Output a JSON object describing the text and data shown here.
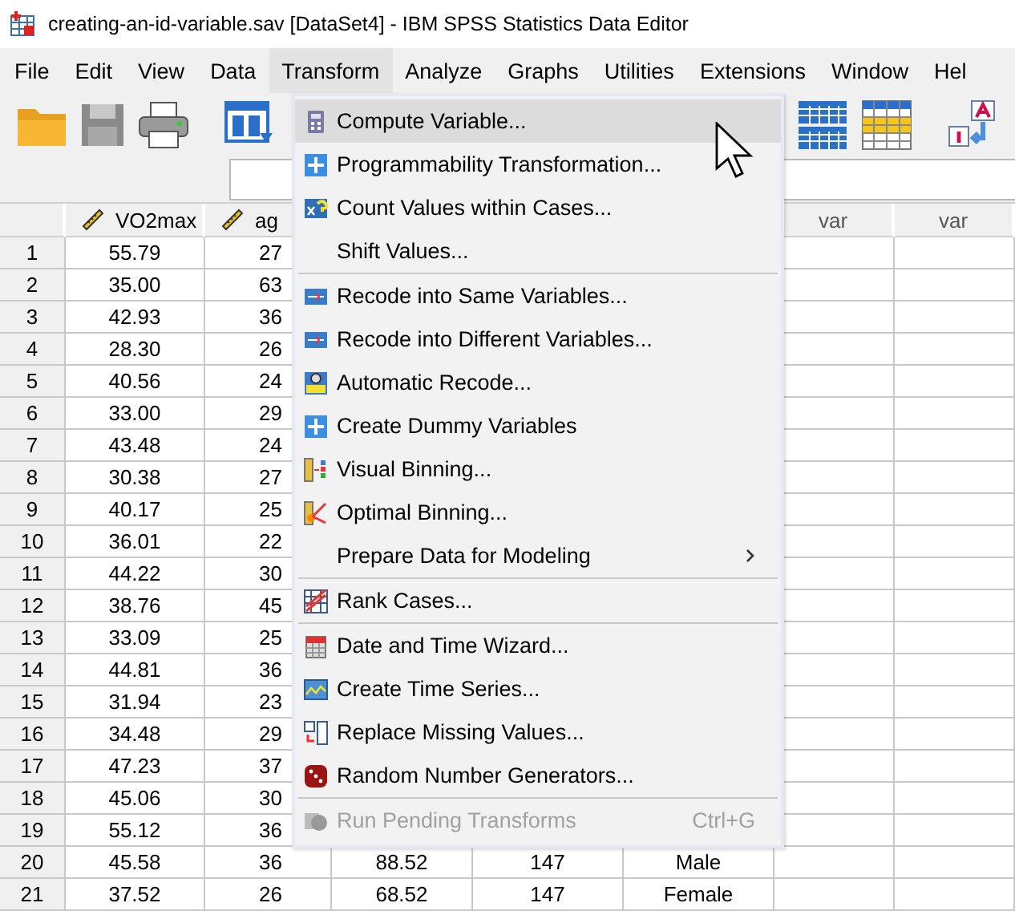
{
  "window": {
    "title": "creating-an-id-variable.sav [DataSet4] - IBM SPSS Statistics Data Editor"
  },
  "menubar": [
    {
      "label": "File",
      "selected": false
    },
    {
      "label": "Edit",
      "selected": false
    },
    {
      "label": "View",
      "selected": false
    },
    {
      "label": "Data",
      "selected": false
    },
    {
      "label": "Transform",
      "selected": true
    },
    {
      "label": "Analyze",
      "selected": false
    },
    {
      "label": "Graphs",
      "selected": false
    },
    {
      "label": "Utilities",
      "selected": false
    },
    {
      "label": "Extensions",
      "selected": false
    },
    {
      "label": "Window",
      "selected": false
    },
    {
      "label": "Hel",
      "selected": false
    }
  ],
  "columns": [
    {
      "header": "VO2max",
      "kind": "scale"
    },
    {
      "header": "ag",
      "kind": "scale"
    },
    {
      "kind": "covered"
    },
    {
      "kind": "covered"
    },
    {
      "kind": "covered"
    },
    {
      "header": "var",
      "kind": "empty"
    },
    {
      "header": "var",
      "kind": "empty"
    }
  ],
  "rows": [
    {
      "number": "1",
      "cells": [
        "55.79",
        "27"
      ]
    },
    {
      "number": "2",
      "cells": [
        "35.00",
        "63"
      ]
    },
    {
      "number": "3",
      "cells": [
        "42.93",
        "36"
      ]
    },
    {
      "number": "4",
      "cells": [
        "28.30",
        "26"
      ]
    },
    {
      "number": "5",
      "cells": [
        "40.56",
        "24"
      ]
    },
    {
      "number": "6",
      "cells": [
        "33.00",
        "29"
      ]
    },
    {
      "number": "7",
      "cells": [
        "43.48",
        "24"
      ]
    },
    {
      "number": "8",
      "cells": [
        "30.38",
        "27"
      ]
    },
    {
      "number": "9",
      "cells": [
        "40.17",
        "25"
      ]
    },
    {
      "number": "10",
      "cells": [
        "36.01",
        "22"
      ]
    },
    {
      "number": "11",
      "cells": [
        "44.22",
        "30"
      ]
    },
    {
      "number": "12",
      "cells": [
        "38.76",
        "45"
      ]
    },
    {
      "number": "13",
      "cells": [
        "33.09",
        "25"
      ]
    },
    {
      "number": "14",
      "cells": [
        "44.81",
        "36"
      ]
    },
    {
      "number": "15",
      "cells": [
        "31.94",
        "23"
      ]
    },
    {
      "number": "16",
      "cells": [
        "34.48",
        "29"
      ]
    },
    {
      "number": "17",
      "cells": [
        "47.23",
        "37"
      ]
    },
    {
      "number": "18",
      "cells": [
        "45.06",
        "30"
      ]
    },
    {
      "number": "19",
      "cells": [
        "55.12",
        "36"
      ]
    },
    {
      "number": "20",
      "cells": [
        "45.58",
        "36",
        "88.52",
        "147",
        "Male"
      ]
    },
    {
      "number": "21",
      "cells": [
        "37.52",
        "26",
        "68.52",
        "147",
        "Female"
      ]
    }
  ],
  "transform_menu": [
    {
      "kind": "item",
      "label": "Compute Variable...",
      "selected": true,
      "disabled": false
    },
    {
      "kind": "item",
      "label": "Programmability Transformation...",
      "selected": false,
      "disabled": false
    },
    {
      "kind": "item",
      "label": "Count Values within Cases...",
      "selected": false,
      "disabled": false
    },
    {
      "kind": "item",
      "label": "Shift Values...",
      "selected": false,
      "disabled": false
    },
    {
      "kind": "separator"
    },
    {
      "kind": "item",
      "label": "Recode into Same Variables...",
      "selected": false,
      "disabled": false
    },
    {
      "kind": "item",
      "label": "Recode into Different Variables...",
      "selected": false,
      "disabled": false
    },
    {
      "kind": "item",
      "label": "Automatic Recode...",
      "selected": false,
      "disabled": false
    },
    {
      "kind": "item",
      "label": "Create Dummy Variables",
      "selected": false,
      "disabled": false
    },
    {
      "kind": "item",
      "label": "Visual Binning...",
      "selected": false,
      "disabled": false
    },
    {
      "kind": "item",
      "label": "Optimal Binning...",
      "selected": false,
      "disabled": false
    },
    {
      "kind": "submenu",
      "label": "Prepare Data for Modeling",
      "selected": false,
      "disabled": false
    },
    {
      "kind": "separator"
    },
    {
      "kind": "item",
      "label": "Rank Cases...",
      "selected": false,
      "disabled": false
    },
    {
      "kind": "separator"
    },
    {
      "kind": "item",
      "label": "Date and Time Wizard...",
      "selected": false,
      "disabled": false
    },
    {
      "kind": "item",
      "label": "Create Time Series...",
      "selected": false,
      "disabled": false
    },
    {
      "kind": "item",
      "label": "Replace Missing Values...",
      "selected": false,
      "disabled": false
    },
    {
      "kind": "item",
      "label": "Random Number Generators...",
      "selected": false,
      "disabled": false
    },
    {
      "kind": "separator"
    },
    {
      "kind": "item",
      "label": "Run Pending Transforms",
      "shortcut": "Ctrl+G",
      "selected": false,
      "disabled": true
    }
  ]
}
